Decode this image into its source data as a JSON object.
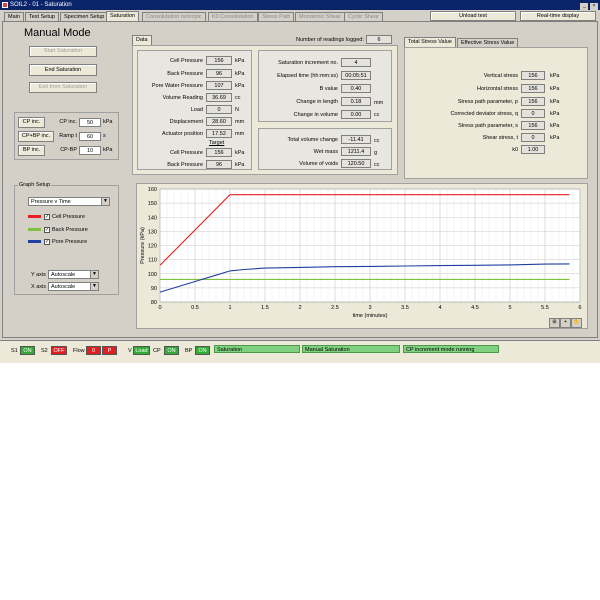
{
  "window": {
    "title": "SOIL2 - 01 - Saturation"
  },
  "tabs": [
    {
      "label": "Main"
    },
    {
      "label": "Test Setup"
    },
    {
      "label": "Specimen Setup"
    },
    {
      "label": "Saturation"
    },
    {
      "label": "Consolidation Isotropic"
    },
    {
      "label": "K0 Consolidation"
    },
    {
      "label": "Stress Path"
    },
    {
      "label": "Monotonic Shear"
    },
    {
      "label": "Cyclic Shear"
    }
  ],
  "top_buttons": {
    "unload": "Unload test",
    "realtime": "Real-time display"
  },
  "mode": {
    "title": "Manual Mode",
    "start": "Start Saturation",
    "end": "End Saturation",
    "exit": "Exit from Saturation"
  },
  "controls": {
    "cp_inc_btn": "CP inc.",
    "cpbp_inc_btn": "CP+BP inc.",
    "bp_inc_btn": "BP inc.",
    "cp_inc_label": "CP inc.",
    "cp_inc_value": "50",
    "cp_inc_unit": "kPa",
    "ramp_label": "Ramp t",
    "ramp_value": "60",
    "ramp_unit": "s",
    "cpbp_label": "CP-BP",
    "cpbp_value": "10",
    "cpbp_unit": "kPa"
  },
  "data_tab": {
    "label": "Data"
  },
  "readings_logged": {
    "label": "Number of readings logged:",
    "value": "6"
  },
  "readings": [
    {
      "label": "Cell Pressure",
      "value": "156",
      "unit": "kPa"
    },
    {
      "label": "Back Pressure",
      "value": "96",
      "unit": "kPa"
    },
    {
      "label": "Pore Water Pressure",
      "value": "107",
      "unit": "kPa"
    },
    {
      "label": "Volume Reading",
      "value": "36.69",
      "unit": "cc"
    },
    {
      "label": "Load",
      "value": "0",
      "unit": "N"
    },
    {
      "label": "Displacement",
      "value": "28.60",
      "unit": "mm"
    },
    {
      "label": "Actuator position",
      "value": "17.52",
      "unit": "mm"
    }
  ],
  "target": {
    "label": "Target",
    "rows": [
      {
        "label": "Cell Pressure",
        "value": "156",
        "unit": "kPa"
      },
      {
        "label": "Back Pressure",
        "value": "96",
        "unit": "kPa"
      }
    ]
  },
  "saturation": [
    {
      "label": "Saturation increment no.",
      "value": "4",
      "unit": ""
    },
    {
      "label": "Elapsed time (hh:mm:ss)",
      "value": "00:05:51",
      "unit": ""
    },
    {
      "label": "B value",
      "value": "0.40",
      "unit": ""
    },
    {
      "label": "Change in length",
      "value": "0.18",
      "unit": "mm"
    },
    {
      "label": "Change in volume",
      "value": "0.00",
      "unit": "cc"
    }
  ],
  "volume": [
    {
      "label": "Total volume change",
      "value": "-11.41",
      "unit": "cc"
    },
    {
      "label": "Wet mass",
      "value": "1211.4",
      "unit": "g"
    },
    {
      "label": "Volume of voids",
      "value": "120.50",
      "unit": "cc"
    }
  ],
  "stress_tabs": {
    "total": "Total Stress Value",
    "effective": "Effective Stress Value"
  },
  "stress": [
    {
      "label": "Vertical stress",
      "value": "156",
      "unit": "kPa"
    },
    {
      "label": "Horizontal stress",
      "value": "156",
      "unit": "kPa"
    },
    {
      "label": "Stress path parameter, p",
      "value": "156",
      "unit": "kPa"
    },
    {
      "label": "Corrected deviator stress, q",
      "value": "0",
      "unit": "kPa"
    },
    {
      "label": "Stress path parameter, s",
      "value": "156",
      "unit": "kPa"
    },
    {
      "label": "Shear stress, t",
      "value": "0",
      "unit": "kPa"
    },
    {
      "label": "k0",
      "value": "1.00",
      "unit": ""
    }
  ],
  "graph_setup": {
    "title": "Graph Setup",
    "graph_select": "Pressure v Time",
    "legend": [
      {
        "name": "Cell Pressure",
        "color": "#e82020"
      },
      {
        "name": "Back Pressure",
        "color": "#80c040"
      },
      {
        "name": "Pore Pressure",
        "color": "#2040a0"
      }
    ],
    "y_axis_label": "Y axis",
    "y_axis_value": "Autoscale",
    "x_axis_label": "X axis",
    "x_axis_value": "Autoscale"
  },
  "chart_data": {
    "type": "line",
    "xlabel": "time (minutes)",
    "ylabel": "Pressure (kPa)",
    "xlim": [
      0,
      6
    ],
    "ylim": [
      80,
      160
    ],
    "xticks": [
      "0",
      "0.5",
      "1",
      "1.5",
      "2",
      "2.5",
      "3",
      "3.5",
      "4",
      "4.5",
      "5",
      "5.5",
      "6"
    ],
    "yticks": [
      "80",
      "90",
      "100",
      "110",
      "120",
      "130",
      "140",
      "150",
      "160"
    ],
    "series": [
      {
        "name": "Cell Pressure",
        "color": "#e82020",
        "x": [
          0,
          1.0,
          1.05,
          5.85
        ],
        "y": [
          106,
          156,
          156,
          156
        ]
      },
      {
        "name": "Back Pressure",
        "color": "#80c040",
        "x": [
          0,
          5.85
        ],
        "y": [
          96,
          96
        ]
      },
      {
        "name": "Pore Pressure",
        "color": "#2040a0",
        "x": [
          0,
          0.2,
          0.4,
          0.6,
          0.8,
          1.0,
          1.2,
          1.5,
          2.0,
          2.5,
          3.0,
          3.5,
          4.0,
          4.5,
          5.0,
          5.5,
          5.85
        ],
        "y": [
          87,
          90,
          93,
          96,
          99,
          102,
          103,
          104,
          104.5,
          105,
          105.2,
          105.5,
          105.8,
          106,
          106.3,
          106.8,
          107
        ]
      }
    ]
  },
  "status": {
    "s1_label": "S1",
    "s1_value": "ON",
    "s2_label": "S2",
    "s2_value": "OFF",
    "flow_label": "Flow",
    "flow_0": "0",
    "flow_p": "P",
    "v_label": "V",
    "v_value": "Load",
    "cp_label": "CP",
    "cp_value": "ON",
    "bp_label": "BP",
    "bp_value": "ON",
    "msg1": "Saturation",
    "msg2": "Manual Saturation",
    "msg3": "CP increment mode running"
  }
}
